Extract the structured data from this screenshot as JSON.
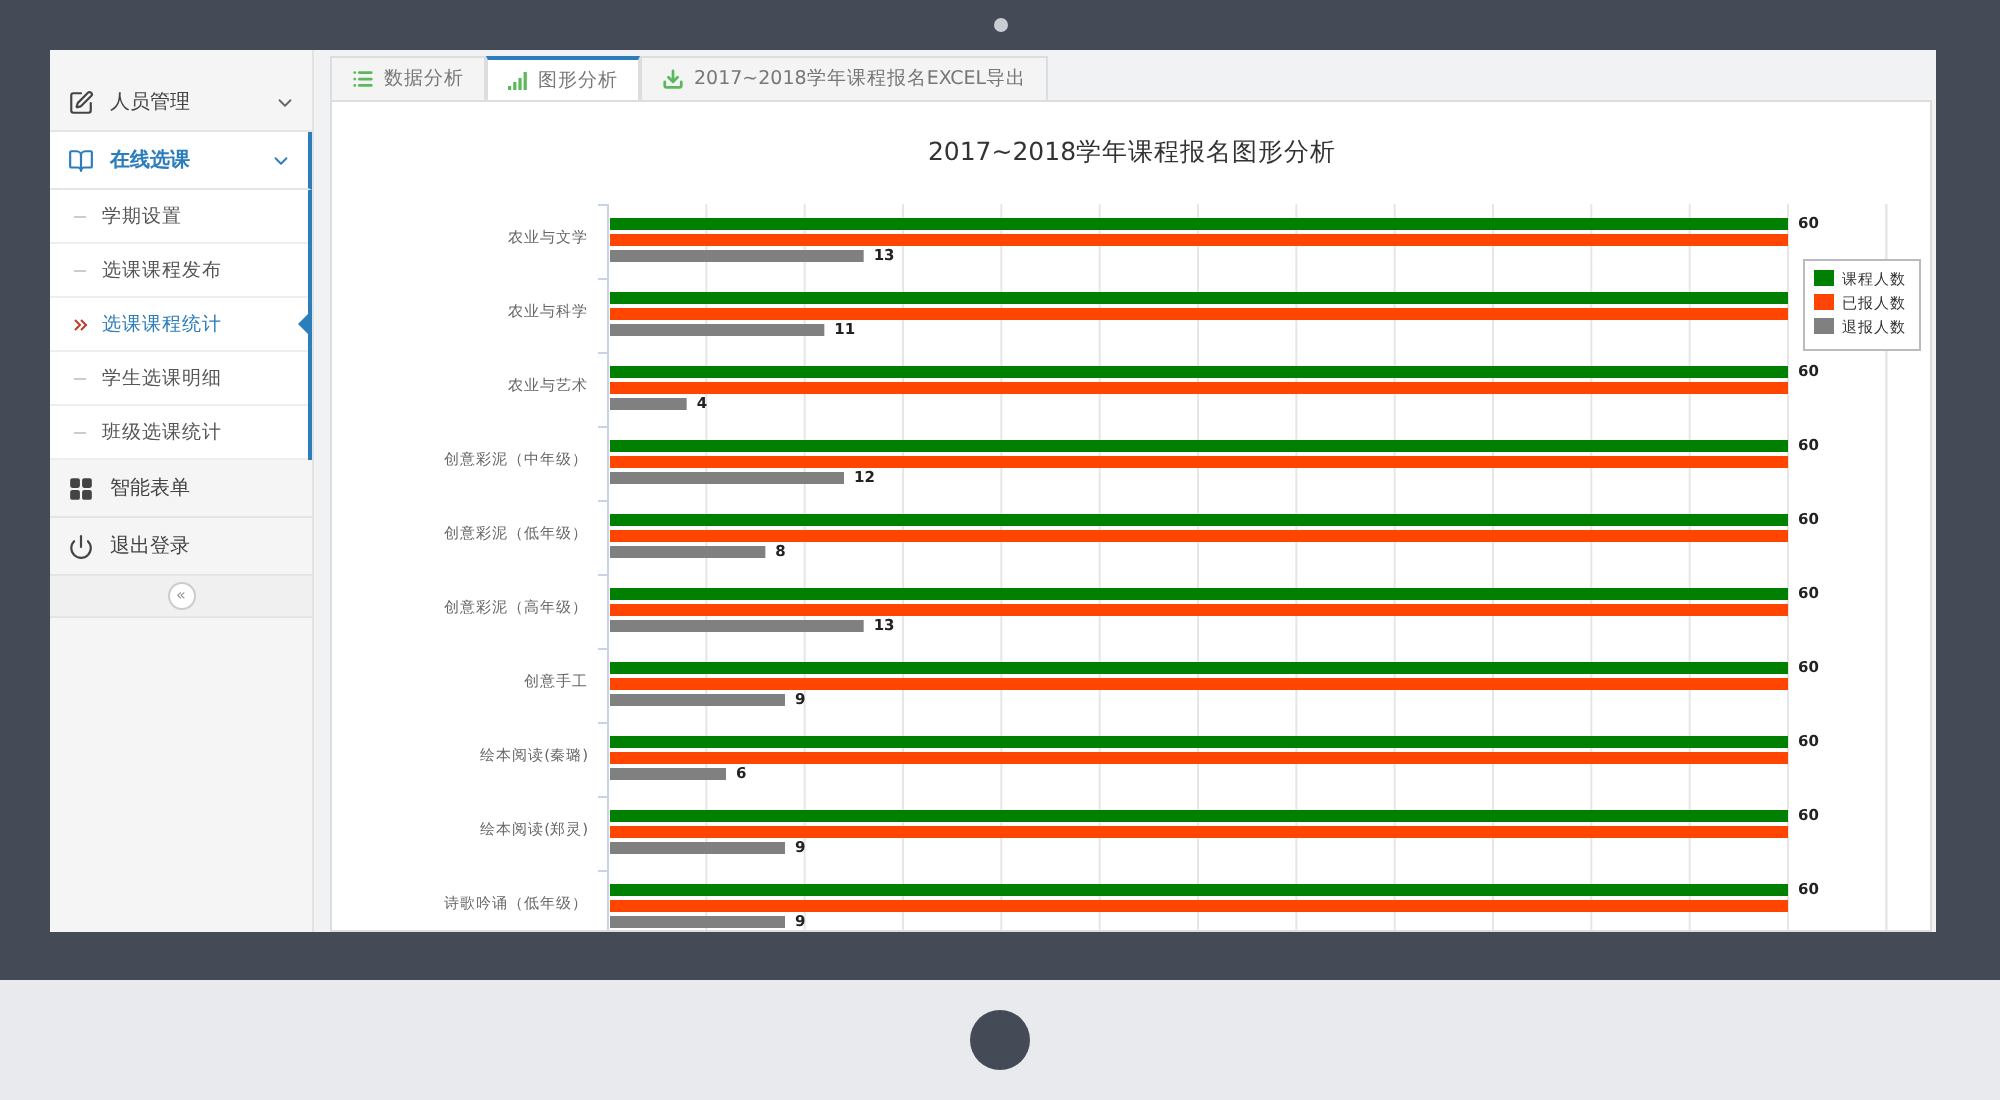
{
  "sidebar": {
    "items": [
      {
        "label": "人员管理",
        "kind": "edit",
        "chevron": true,
        "selected": false
      },
      {
        "label": "在线选课",
        "kind": "book",
        "chevron": true,
        "selected": true,
        "children": [
          {
            "label": "学期设置",
            "selected": false
          },
          {
            "label": "选课课程发布",
            "selected": false
          },
          {
            "label": "选课课程统计",
            "selected": true
          },
          {
            "label": "学生选课明细",
            "selected": false
          },
          {
            "label": "班级选课统计",
            "selected": false
          }
        ]
      },
      {
        "label": "智能表单",
        "kind": "grid",
        "chevron": false,
        "selected": false
      },
      {
        "label": "退出登录",
        "kind": "power",
        "chevron": false,
        "selected": false
      }
    ],
    "collapse_button": "«"
  },
  "tabs": [
    {
      "label": "数据分析",
      "kind": "list",
      "selected": false
    },
    {
      "label": "图形分析",
      "kind": "signal",
      "selected": true
    },
    {
      "label": "2017~2018学年课程报名EXCEL导出",
      "kind": "download",
      "selected": false
    }
  ],
  "chart_data": {
    "type": "bar",
    "orientation": "horizontal",
    "title": "2017~2018学年课程报名图形分析",
    "categories": [
      "农业与文学",
      "农业与科学",
      "农业与艺术",
      "创意彩泥（中年级）",
      "创意彩泥（低年级）",
      "创意彩泥（高年级）",
      "创意手工",
      "绘本阅读(秦璐)",
      "绘本阅读(郑灵)",
      "诗歌吟诵（低年级）"
    ],
    "xlim": [
      0,
      65
    ],
    "legend": true,
    "series": [
      {
        "name": "课程人数",
        "color": "#008000",
        "values": [
          60,
          60,
          60,
          60,
          60,
          60,
          60,
          60,
          60,
          60
        ],
        "value_labels": [
          "60",
          null,
          "60",
          "60",
          "60",
          "60",
          "60",
          "60",
          "60",
          "60"
        ]
      },
      {
        "name": "已报人数",
        "color": "#ff4500",
        "values": [
          60,
          60,
          60,
          60,
          60,
          60,
          60,
          60,
          60,
          60
        ],
        "value_labels": [
          null,
          null,
          null,
          null,
          null,
          null,
          null,
          null,
          null,
          null
        ]
      },
      {
        "name": "退报人数",
        "color": "#808080",
        "values": [
          13,
          11,
          4,
          12,
          8,
          13,
          9,
          6,
          9,
          9
        ],
        "value_labels": [
          "13",
          "11",
          "4",
          "12",
          "8",
          "13",
          "9",
          "6",
          "9",
          "9"
        ]
      }
    ]
  }
}
